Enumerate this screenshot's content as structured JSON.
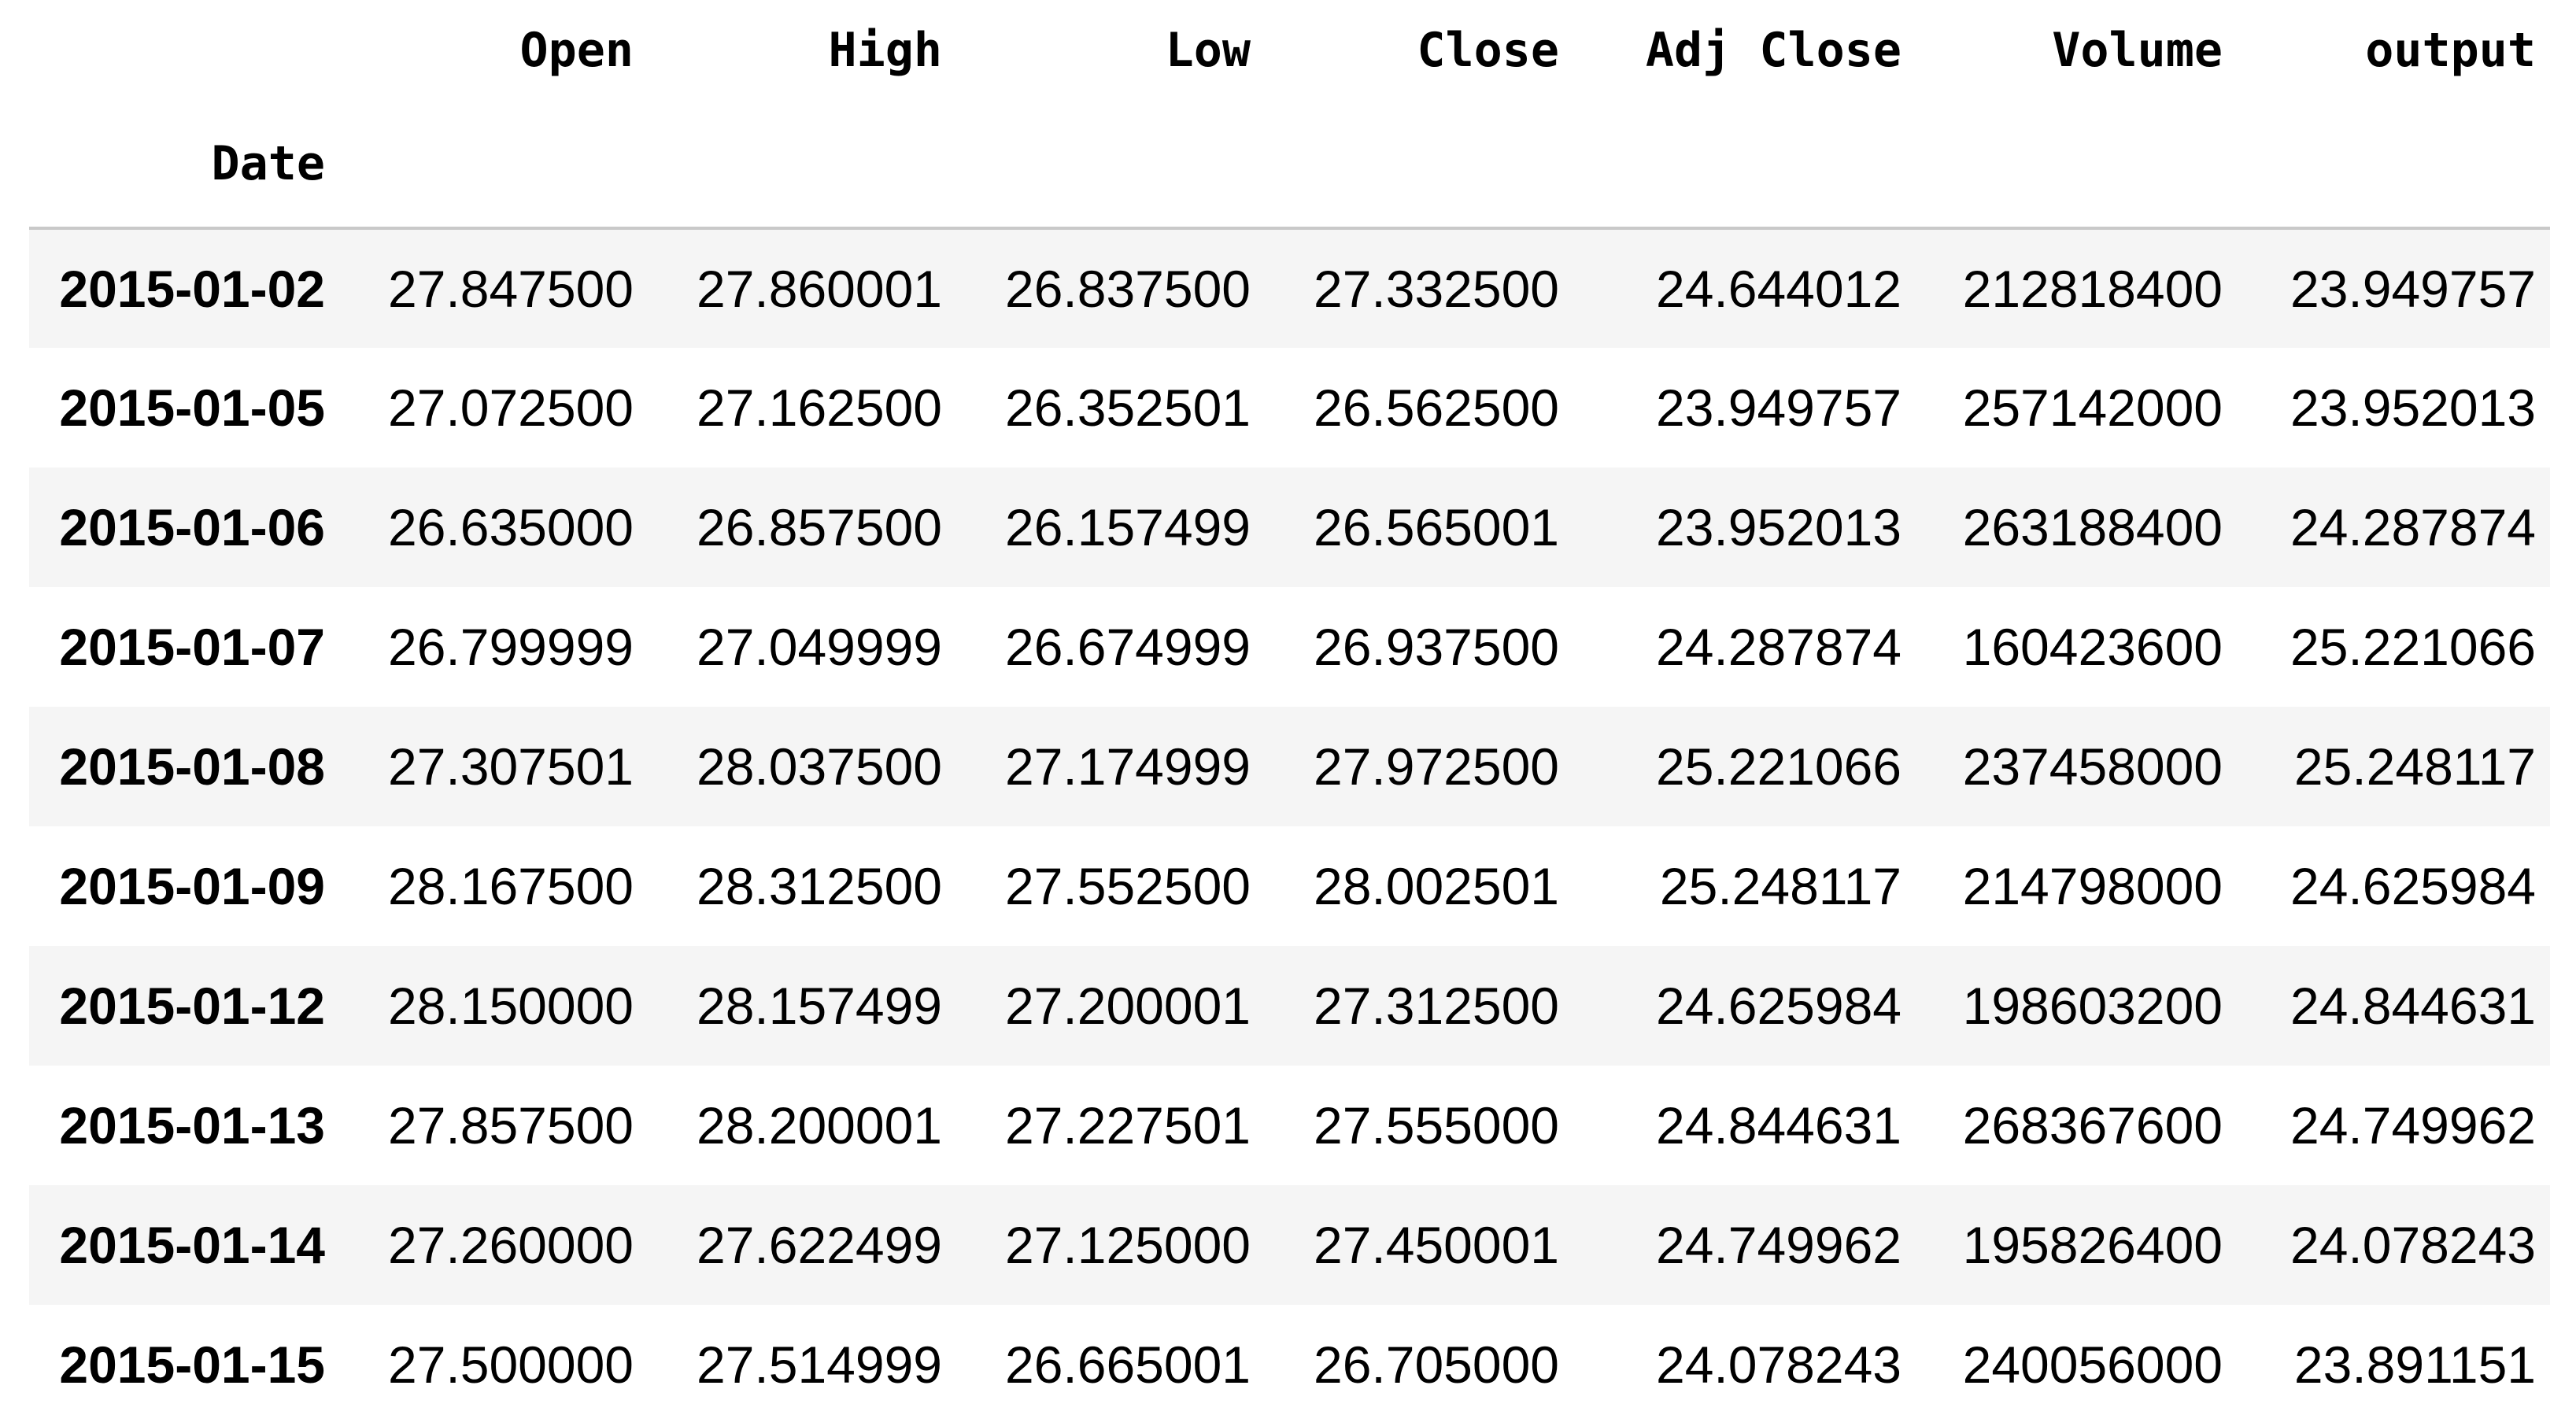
{
  "dataframe": {
    "columns": [
      "Open",
      "High",
      "Low",
      "Close",
      "Adj Close",
      "Volume",
      "output"
    ],
    "index_name": "Date",
    "rows": [
      {
        "date": "2015-01-02",
        "values": [
          "27.847500",
          "27.860001",
          "26.837500",
          "27.332500",
          "24.644012",
          "212818400",
          "23.949757"
        ]
      },
      {
        "date": "2015-01-05",
        "values": [
          "27.072500",
          "27.162500",
          "26.352501",
          "26.562500",
          "23.949757",
          "257142000",
          "23.952013"
        ]
      },
      {
        "date": "2015-01-06",
        "values": [
          "26.635000",
          "26.857500",
          "26.157499",
          "26.565001",
          "23.952013",
          "263188400",
          "24.287874"
        ]
      },
      {
        "date": "2015-01-07",
        "values": [
          "26.799999",
          "27.049999",
          "26.674999",
          "26.937500",
          "24.287874",
          "160423600",
          "25.221066"
        ]
      },
      {
        "date": "2015-01-08",
        "values": [
          "27.307501",
          "28.037500",
          "27.174999",
          "27.972500",
          "25.221066",
          "237458000",
          "25.248117"
        ]
      },
      {
        "date": "2015-01-09",
        "values": [
          "28.167500",
          "28.312500",
          "27.552500",
          "28.002501",
          "25.248117",
          "214798000",
          "24.625984"
        ]
      },
      {
        "date": "2015-01-12",
        "values": [
          "28.150000",
          "28.157499",
          "27.200001",
          "27.312500",
          "24.625984",
          "198603200",
          "24.844631"
        ]
      },
      {
        "date": "2015-01-13",
        "values": [
          "27.857500",
          "28.200001",
          "27.227501",
          "27.555000",
          "24.844631",
          "268367600",
          "24.749962"
        ]
      },
      {
        "date": "2015-01-14",
        "values": [
          "27.260000",
          "27.622499",
          "27.125000",
          "27.450001",
          "24.749962",
          "195826400",
          "24.078243"
        ]
      },
      {
        "date": "2015-01-15",
        "values": [
          "27.500000",
          "27.514999",
          "26.665001",
          "26.705000",
          "24.078243",
          "240056000",
          "23.891151"
        ]
      }
    ]
  }
}
